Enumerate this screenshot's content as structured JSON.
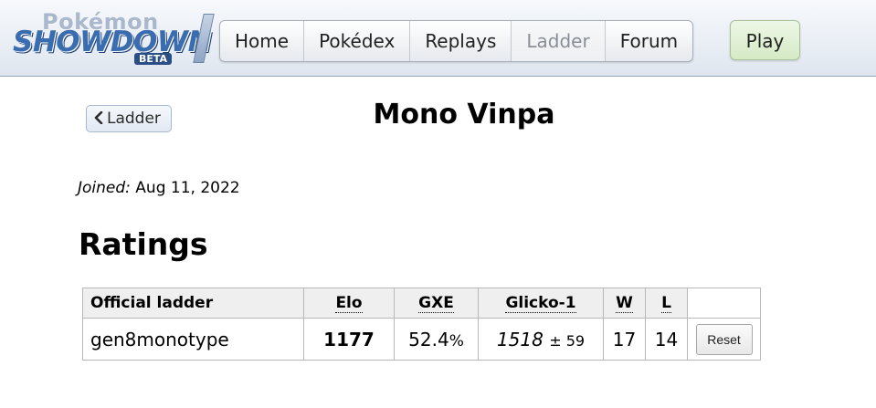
{
  "header": {
    "logo": {
      "line1": "Pokémon",
      "line2": "SHOWDOWN",
      "badge": "BETA"
    },
    "nav": [
      "Home",
      "Pokédex",
      "Replays",
      "Ladder",
      "Forum"
    ],
    "active_tab": "Ladder",
    "play_label": "Play"
  },
  "main": {
    "back_label": "Ladder",
    "username": "Mono Vinpa",
    "joined_label": "Joined:",
    "joined_date": "Aug 11, 2022",
    "ratings_heading": "Ratings",
    "table": {
      "headers": {
        "ladder": "Official ladder",
        "elo": "Elo",
        "gxe": "GXE",
        "glicko": "Glicko-1",
        "w": "W",
        "l": "L"
      },
      "rows": [
        {
          "format": "gen8monotype",
          "elo": "1177",
          "gxe": "52.4",
          "gxe_unit": "%",
          "glicko": "1518",
          "glicko_dev": "± 59",
          "w": "17",
          "l": "14",
          "reset_label": "Reset"
        }
      ]
    }
  }
}
